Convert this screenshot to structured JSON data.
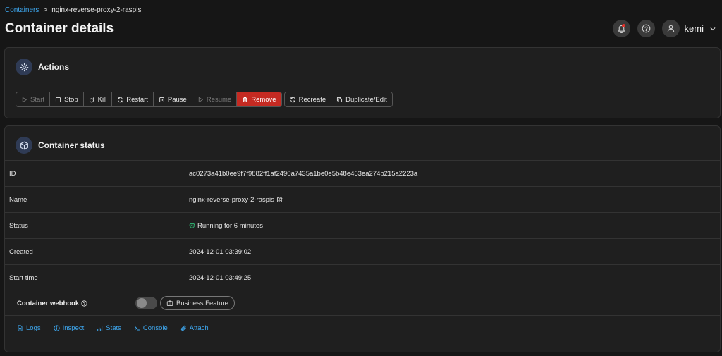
{
  "breadcrumb": {
    "root": "Containers",
    "separator": ">",
    "current": "nginx-reverse-proxy-2-raspis"
  },
  "page_title": "Container details",
  "header": {
    "user_name": "kemi"
  },
  "actions_card": {
    "title": "Actions",
    "group1": [
      {
        "label": "Start",
        "icon": "play-icon",
        "disabled": true
      },
      {
        "label": "Stop",
        "icon": "stop-icon",
        "disabled": false
      },
      {
        "label": "Kill",
        "icon": "bomb-icon",
        "disabled": false
      },
      {
        "label": "Restart",
        "icon": "refresh-icon",
        "disabled": false
      },
      {
        "label": "Pause",
        "icon": "pause-icon",
        "disabled": false
      },
      {
        "label": "Resume",
        "icon": "play-icon",
        "disabled": true
      },
      {
        "label": "Remove",
        "icon": "trash-icon",
        "disabled": false
      }
    ],
    "group2": [
      {
        "label": "Recreate",
        "icon": "refresh-icon"
      },
      {
        "label": "Duplicate/Edit",
        "icon": "copy-icon"
      }
    ]
  },
  "status_card": {
    "title": "Container status",
    "rows": {
      "id": {
        "label": "ID",
        "value": "ac0273a41b0ee9f7f9882ff1af2490a7435a1be0e5b48e463ea274b215a2223a"
      },
      "name": {
        "label": "Name",
        "value": "nginx-reverse-proxy-2-raspis"
      },
      "status": {
        "label": "Status",
        "value": "Running for 6 minutes"
      },
      "created": {
        "label": "Created",
        "value": "2024-12-01 03:39:02"
      },
      "start_time": {
        "label": "Start time",
        "value": "2024-12-01 03:49:25"
      }
    },
    "webhook": {
      "label": "Container webhook",
      "badge": "Business Feature",
      "enabled": false
    },
    "links": {
      "logs": "Logs",
      "inspect": "Inspect",
      "stats": "Stats",
      "console": "Console",
      "attach": "Attach"
    }
  },
  "colors": {
    "accent": "#3ea8f0",
    "danger": "#c52a22",
    "running": "#2fb873",
    "background": "#161616",
    "card": "#1f1f1f"
  }
}
